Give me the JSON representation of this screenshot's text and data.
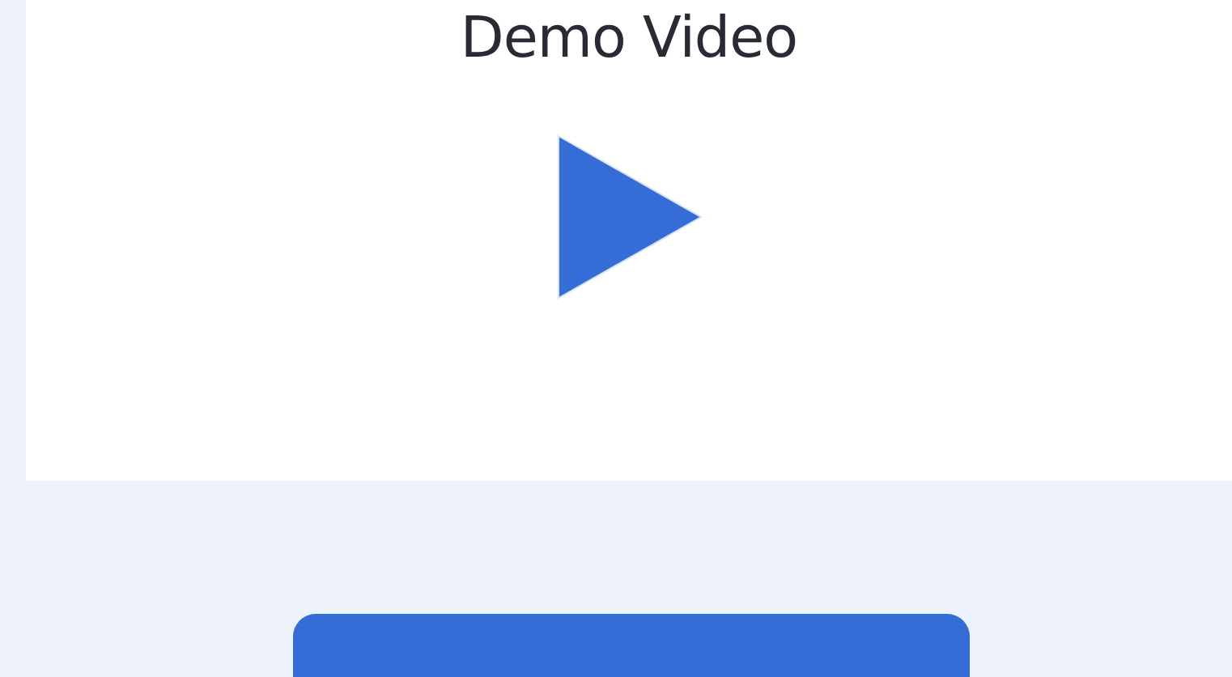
{
  "video": {
    "title": "Demo Video"
  }
}
